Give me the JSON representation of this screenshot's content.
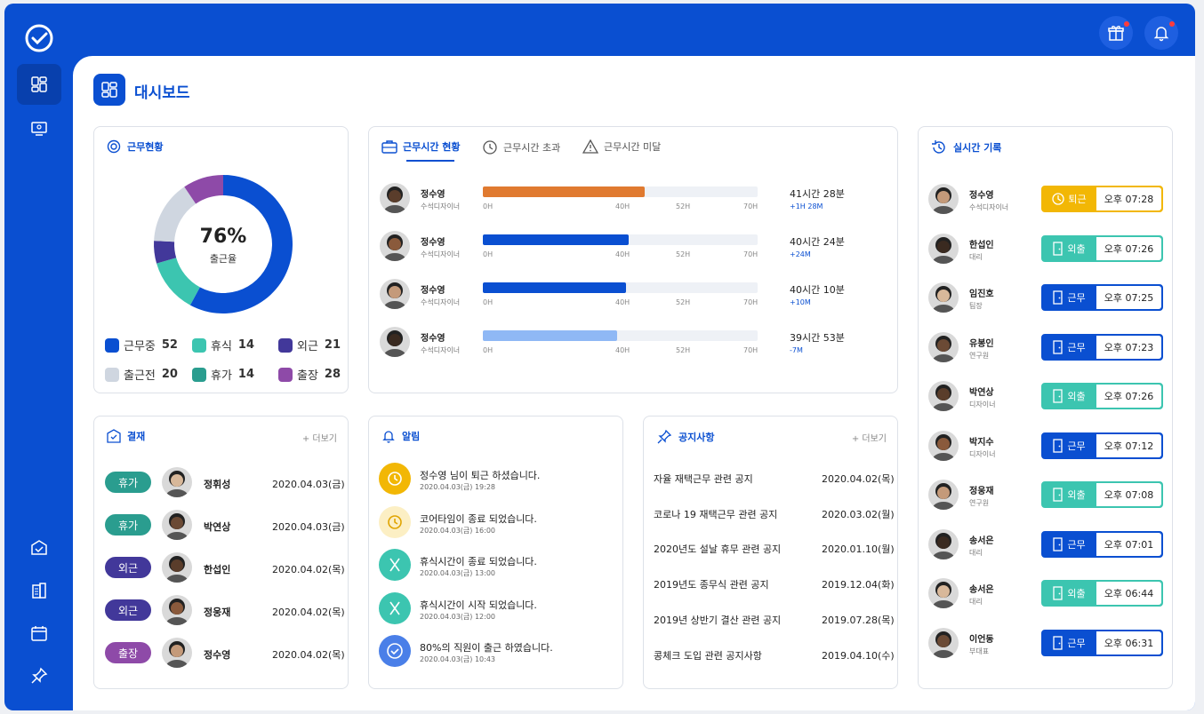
{
  "page_title": "대시보드",
  "colors": {
    "brand": "#0a4fd1",
    "teal": "#3cc5b0",
    "purple": "#42389a",
    "gray": "#cfd6e0",
    "green": "#2a9d8f",
    "magenta": "#8e4aa8",
    "orange": "#e07a30",
    "lightblue": "#8fb8f5",
    "yellow": "#f2b705"
  },
  "attendance": {
    "title": "근무현황",
    "percent": "76%",
    "percent_label": "출근율",
    "legend": [
      {
        "label": "근무중",
        "value": "52",
        "color": "#0a4fd1"
      },
      {
        "label": "휴식",
        "value": "14",
        "color": "#3cc5b0"
      },
      {
        "label": "외근",
        "value": "21",
        "color": "#42389a"
      },
      {
        "label": "출근전",
        "value": "20",
        "color": "#cfd6e0"
      },
      {
        "label": "휴가",
        "value": "14",
        "color": "#2a9d8f"
      },
      {
        "label": "출장",
        "value": "28",
        "color": "#8e4aa8"
      }
    ]
  },
  "chart_data": {
    "type": "pie",
    "title": "근무현황",
    "categories": [
      "근무중",
      "휴식",
      "외근",
      "출근전",
      "휴가",
      "출장"
    ],
    "values": [
      55,
      12,
      5,
      14,
      0,
      9
    ],
    "center_label": "76%"
  },
  "worktime": {
    "tabs": [
      "근무시간 현황",
      "근무시간 초과",
      "근무시간 미달"
    ],
    "axis": [
      "0H",
      "40H",
      "52H",
      "70H"
    ],
    "rows": [
      {
        "name": "정수영",
        "role": "수석디자이너",
        "hours": "41시간 28분",
        "delta": "+1H 28M",
        "fraction": 0.59,
        "color": "#e07a30"
      },
      {
        "name": "정수영",
        "role": "수석디자이너",
        "hours": "40시간 24분",
        "delta": "+24M",
        "fraction": 0.53,
        "color": "#0a4fd1"
      },
      {
        "name": "정수영",
        "role": "수석디자이너",
        "hours": "40시간 10분",
        "delta": "+10M",
        "fraction": 0.52,
        "color": "#0a4fd1"
      },
      {
        "name": "정수영",
        "role": "수석디자이너",
        "hours": "39시간 53분",
        "delta": "-7M",
        "fraction": 0.49,
        "color": "#8fb8f5"
      }
    ]
  },
  "approval": {
    "title": "결재",
    "more": "+ 더보기",
    "rows": [
      {
        "type": "휴가",
        "name": "정휘성",
        "date": "2020.04.03(금)",
        "color": "#2a9d8f"
      },
      {
        "type": "휴가",
        "name": "박연상",
        "date": "2020.04.03(금)",
        "color": "#2a9d8f"
      },
      {
        "type": "외근",
        "name": "한섭인",
        "date": "2020.04.02(목)",
        "color": "#42389a"
      },
      {
        "type": "외근",
        "name": "정웅재",
        "date": "2020.04.02(목)",
        "color": "#42389a"
      },
      {
        "type": "출장",
        "name": "정수영",
        "date": "2020.04.02(목)",
        "color": "#8e4aa8"
      }
    ]
  },
  "alerts": {
    "title": "알림",
    "rows": [
      {
        "text": "정수영 님이 퇴근 하셨습니다.",
        "time": "2020.04.03(금) 19:28",
        "icon": "clock-icon",
        "bg": "#f2b705"
      },
      {
        "text": "코어타임이 종료 되었습니다.",
        "time": "2020.04.03(금) 16:00",
        "icon": "clock-icon",
        "bg": "#fcefc4"
      },
      {
        "text": "휴식시간이 종료 되었습니다.",
        "time": "2020.04.03(금) 13:00",
        "icon": "utensils-icon",
        "bg": "#3cc5b0"
      },
      {
        "text": "휴식시간이 시작 되었습니다.",
        "time": "2020.04.03(금) 12:00",
        "icon": "utensils-icon",
        "bg": "#3cc5b0"
      },
      {
        "text": "80%의 직원이 출근 하였습니다.",
        "time": "2020.04.03(금) 10:43",
        "icon": "check-icon",
        "bg": "#4a7fe8"
      }
    ]
  },
  "notices": {
    "title": "공지사항",
    "more": "+ 더보기",
    "rows": [
      {
        "title": "자율 재택근무 관련 공지",
        "date": "2020.04.02(목)"
      },
      {
        "title": "코로나 19 재택근무 관련 공지",
        "date": "2020.03.02(월)"
      },
      {
        "title": "2020년도 설날 휴무 관련 공지",
        "date": "2020.01.10(월)"
      },
      {
        "title": "2019년도 종무식 관련 공지",
        "date": "2019.12.04(화)"
      },
      {
        "title": "2019년 상반기 결산 관련 공지",
        "date": "2019.07.28(목)"
      },
      {
        "title": "콩체크 도입 관련 공지사항",
        "date": "2019.04.10(수)"
      }
    ]
  },
  "realtime": {
    "title": "실시간 기록",
    "rows": [
      {
        "name": "정수영",
        "role": "수석디자이너",
        "status": "퇴근",
        "time": "오후 07:28",
        "color": "#f2b705"
      },
      {
        "name": "한섭인",
        "role": "대리",
        "status": "외출",
        "time": "오후 07:26",
        "color": "#3cc5b0"
      },
      {
        "name": "임진호",
        "role": "팀장",
        "status": "근무",
        "time": "오후 07:25",
        "color": "#0a4fd1"
      },
      {
        "name": "유봉인",
        "role": "연구원",
        "status": "근무",
        "time": "오후 07:23",
        "color": "#0a4fd1"
      },
      {
        "name": "박연상",
        "role": "디자이너",
        "status": "외출",
        "time": "오후 07:26",
        "color": "#3cc5b0"
      },
      {
        "name": "박지수",
        "role": "디자이너",
        "status": "근무",
        "time": "오후 07:12",
        "color": "#0a4fd1"
      },
      {
        "name": "정웅재",
        "role": "연구원",
        "status": "외출",
        "time": "오후 07:08",
        "color": "#3cc5b0"
      },
      {
        "name": "송서은",
        "role": "대리",
        "status": "근무",
        "time": "오후 07:01",
        "color": "#0a4fd1"
      },
      {
        "name": "송서은",
        "role": "대리",
        "status": "외출",
        "time": "오후 06:44",
        "color": "#3cc5b0"
      },
      {
        "name": "이언동",
        "role": "부대표",
        "status": "근무",
        "time": "오후 06:31",
        "color": "#0a4fd1"
      }
    ]
  }
}
